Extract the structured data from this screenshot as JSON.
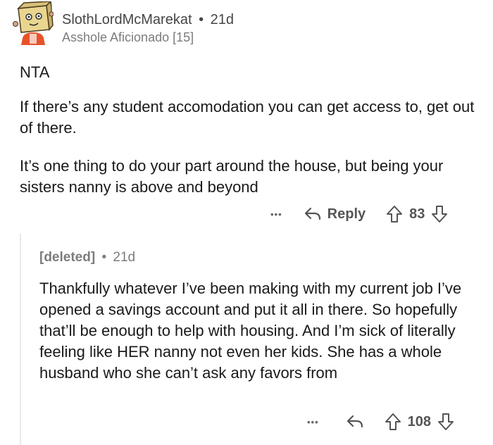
{
  "comment": {
    "username": "SlothLordMcMarekat",
    "separator": "•",
    "time": "21d",
    "flair": "Asshole Aficionado [15]",
    "paragraphs": [
      "NTA",
      "If there’s any student accomodation you can get access to, get out of there.",
      "It’s one thing to do your part around the house, but being your sisters nanny is above and beyond"
    ],
    "actions": {
      "more": "•••",
      "reply_label": "Reply",
      "score": "83"
    }
  },
  "reply": {
    "username": "[deleted]",
    "separator": "•",
    "time": "21d",
    "body": "Thankfully whatever I’ve been making with my current job I’ve opened a savings account and put it all in there. So hopefully that’ll be enough to help with housing. And I’m sick of literally feeling like HER nanny not even her kids. She has a whole husband who she can’t ask any favors from",
    "actions": {
      "more": "•••",
      "score": "108"
    }
  },
  "icons": {
    "avatar": "avatar-icon",
    "reply": "reply-arrow-icon",
    "upvote": "upvote-icon",
    "downvote": "downvote-icon",
    "more": "more-dots-icon"
  }
}
